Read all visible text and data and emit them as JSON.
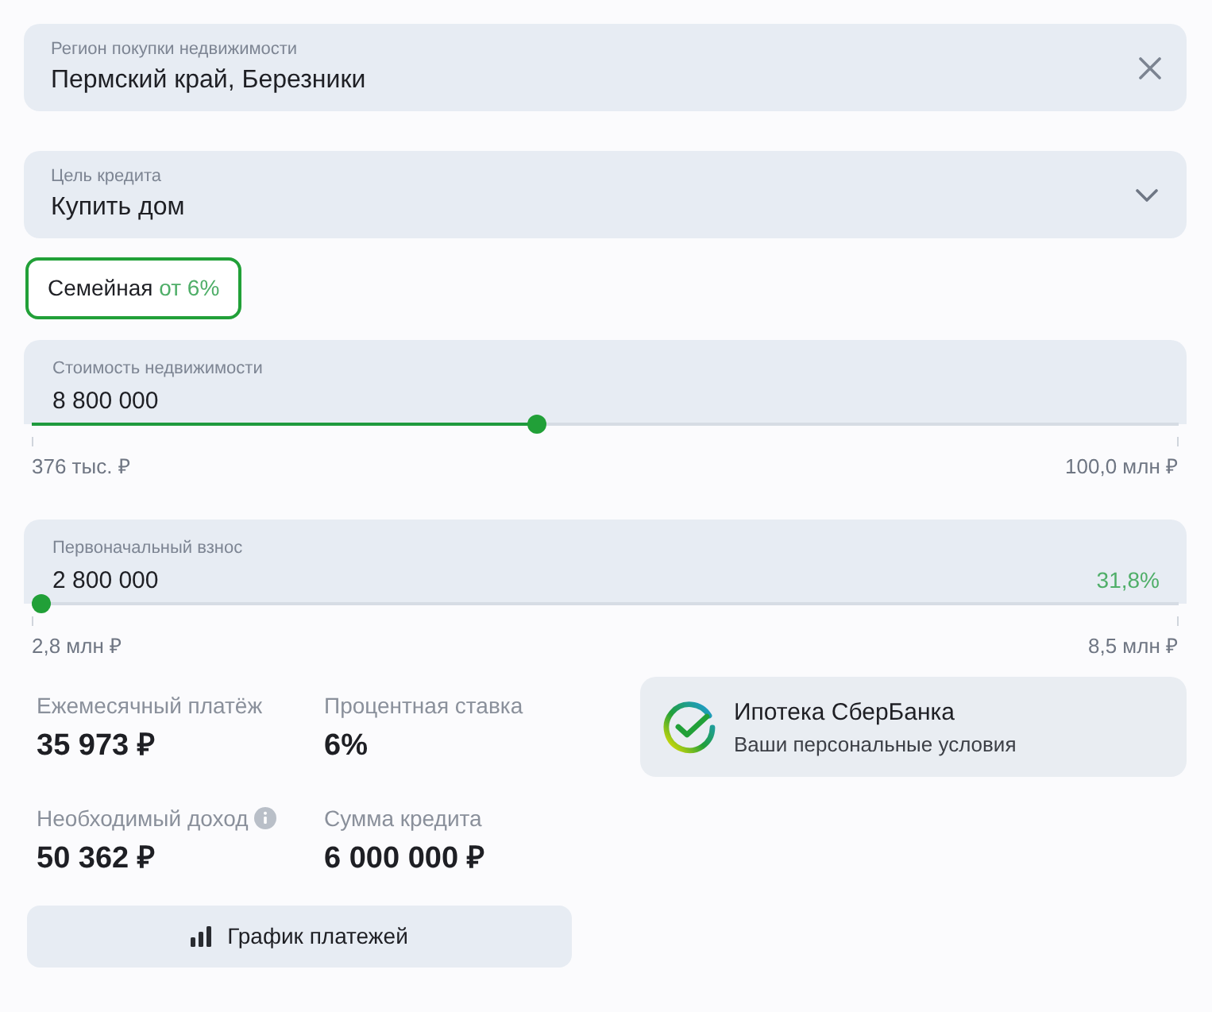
{
  "region_field": {
    "label": "Регион покупки недвижимости",
    "value": "Пермский край, Березники"
  },
  "purpose_field": {
    "label": "Цель кредита",
    "value": "Купить дом"
  },
  "programs": [
    {
      "name": "Семейная",
      "rate": "от 6%",
      "selected": true
    }
  ],
  "sliders": [
    {
      "label": "Стоимость недвижимости",
      "value": "8 800 000",
      "level": 0.44,
      "min": "376 тыс. ₽",
      "max": "100,0 млн ₽"
    },
    {
      "label": "Первоначальный взнос",
      "value": "2 800 000",
      "percent": "31,8%",
      "level": 0,
      "min": "2,8 млн ₽",
      "max": "8,5 млн ₽"
    }
  ],
  "stats": [
    {
      "label": "Ежемесячный платёж",
      "value": "35 973 ₽",
      "info": false
    },
    {
      "label": "Процентная ставка",
      "value": "6%",
      "info": false
    },
    {
      "label": "Необходимый доход",
      "value": "50 362 ₽",
      "info": true
    },
    {
      "label": "Сумма кредита",
      "value": "6 000 000 ₽",
      "info": false
    }
  ],
  "bank_card": {
    "title": "Ипотека СберБанка",
    "subtitle": "Ваши персональные условия"
  },
  "schedule_button": {
    "label": "График платежей"
  }
}
